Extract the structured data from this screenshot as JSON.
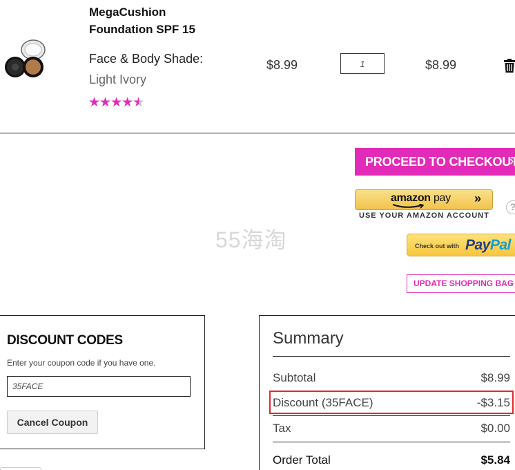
{
  "product": {
    "name": "MegaCushion Foundation SPF 15",
    "shade_label": "Face & Body Shade:",
    "shade_value": "Light Ivory",
    "rating_stars": 4.5,
    "unit_price": "$8.99",
    "quantity": "1",
    "line_total": "$8.99",
    "image_icon": "compact-foundation-image",
    "delete_icon": "trash-icon"
  },
  "actions": {
    "checkout_label": "PROCEED TO CHECKOUT",
    "checkout_chevron": "›",
    "amazon_logo_word": "amazon",
    "amazon_logo_pay": "pay",
    "amazon_arrows": "»",
    "amazon_caption": "USE YOUR AMAZON ACCOUNT",
    "help_symbol": "?",
    "paypal_prefix": "Check out with",
    "paypal_pay": "Pay",
    "paypal_pal": "Pal",
    "update_label": "UPDATE SHOPPING BAG",
    "update_chevron": "›"
  },
  "watermark": "55海淘",
  "discount": {
    "title": "DISCOUNT CODES",
    "help_text": "Enter your coupon code if you have one.",
    "code_value": "35FACE",
    "cancel_label": "Cancel Coupon"
  },
  "summary": {
    "title": "Summary",
    "rows": [
      {
        "label": "Subtotal",
        "value": "$8.99"
      },
      {
        "label": "Discount (35FACE)",
        "value": "-$3.15"
      },
      {
        "label": "Tax",
        "value": "$0.00"
      }
    ],
    "total_label": "Order Total",
    "total_value": "$5.84"
  },
  "colors": {
    "accent": "#e22bb8",
    "highlight": "#e0292b"
  }
}
